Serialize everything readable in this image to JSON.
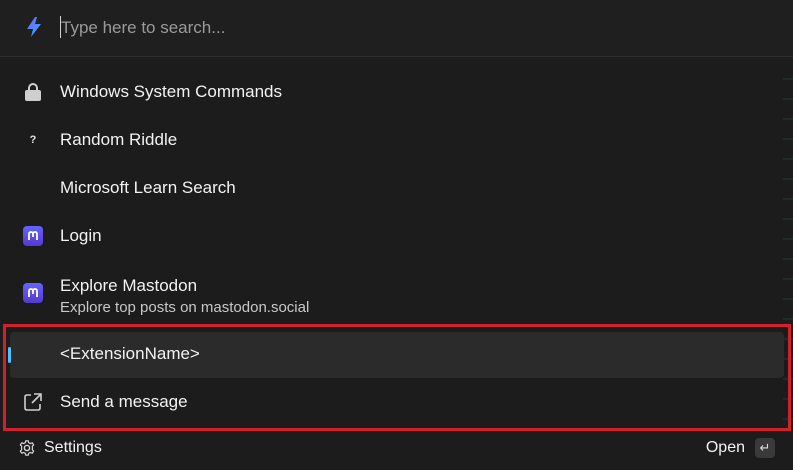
{
  "search": {
    "placeholder": "Type here to search...",
    "value": "",
    "icon": "lightning-bolt-icon"
  },
  "items": [
    {
      "title": "Windows System Commands",
      "subtitle": "",
      "icon": "lock-icon"
    },
    {
      "title": "Random Riddle",
      "subtitle": "",
      "icon": "question-mark-icon",
      "icon_glyph": "?"
    },
    {
      "title": "Microsoft Learn Search",
      "subtitle": "",
      "icon": ""
    },
    {
      "title": "Login",
      "subtitle": "",
      "icon": "mastodon-icon"
    },
    {
      "title": "Explore Mastodon",
      "subtitle": "Explore top posts on mastodon.social",
      "icon": "mastodon-icon"
    },
    {
      "title": "<ExtensionName>",
      "subtitle": "",
      "icon": "",
      "selected": true
    },
    {
      "title": "Send a message",
      "subtitle": "",
      "icon": "external-link-icon"
    }
  ],
  "footer": {
    "settings_label": "Settings",
    "open_label": "Open",
    "enter_glyph": "↵"
  },
  "colors": {
    "accent": "#4cc2ff",
    "highlight_border": "#d0202a",
    "mastodon": "#6364ff"
  }
}
